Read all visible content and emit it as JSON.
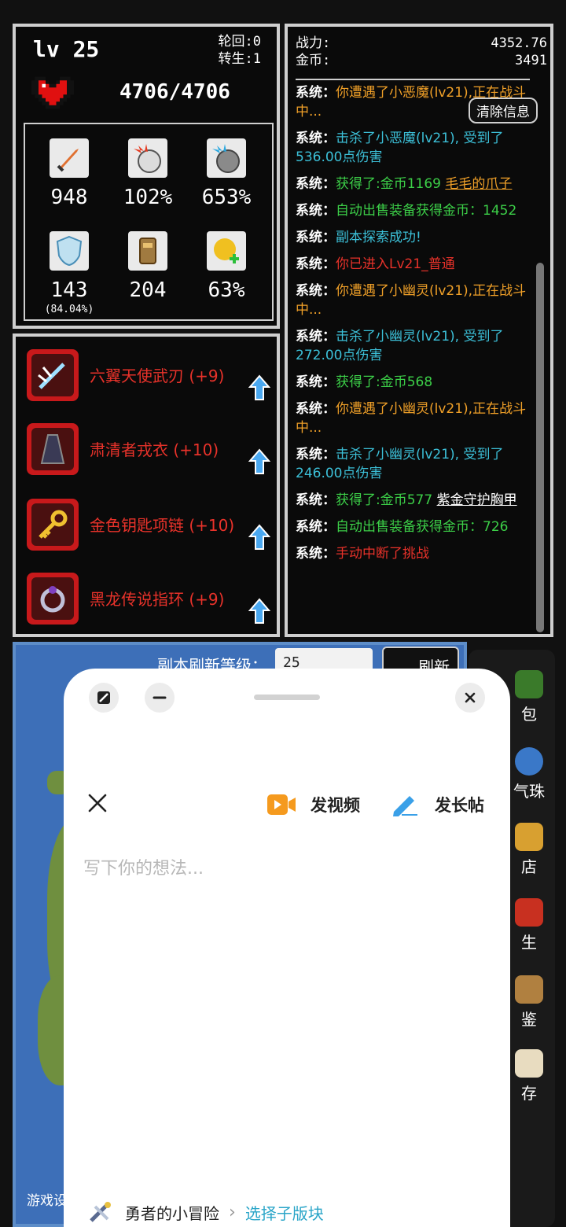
{
  "stats": {
    "level": "lv 25",
    "reincarnation": "轮回:0",
    "rebirth": "转生:1",
    "hp": "4706/4706",
    "attack": "948",
    "crit_rate": "102%",
    "crit_damage": "653%",
    "defense": "143",
    "defense_pct": "(84.04%)",
    "toughness": "204",
    "heal": "63%"
  },
  "equipment": [
    {
      "name": "六翼天使武刃 (+9)"
    },
    {
      "name": "肃清者戎衣 (+10)"
    },
    {
      "name": "金色钥匙项链 (+10)"
    },
    {
      "name": "黑龙传说指环 (+9)"
    }
  ],
  "log_panel": {
    "power_label": "战力:",
    "power_value": "4352.76",
    "gold_label": "金币:",
    "gold_value": "3491",
    "clear_button": "清除信息",
    "sys": "系统：",
    "entries": [
      {
        "text": "你遭遇了小恶魔(lv21),正在战斗中...",
        "color": "#f0a028"
      },
      {
        "text": "击杀了小恶魔(lv21), 受到了536.00点伤害",
        "color": "#3cc0d8"
      },
      {
        "text": "获得了:金币1169",
        "color": "#3ccf48",
        "extra": "毛毛的爪子"
      },
      {
        "text": "自动出售装备获得金币：1452",
        "color": "#3ccf48"
      },
      {
        "text": "副本探索成功!",
        "color": "#3cc0d8"
      },
      {
        "text": "你已进入Lv21_普通",
        "color": "#e8322a"
      },
      {
        "text": "你遭遇了小幽灵(lv21),正在战斗中...",
        "color": "#f0a028"
      },
      {
        "text": "击杀了小幽灵(lv21), 受到了272.00点伤害",
        "color": "#3cc0d8"
      },
      {
        "text": "获得了:金币568",
        "color": "#3ccf48"
      },
      {
        "text": "你遭遇了小幽灵(lv21),正在战斗中...",
        "color": "#f0a028"
      },
      {
        "text": "击杀了小幽灵(lv21), 受到了246.00点伤害",
        "color": "#3cc0d8"
      },
      {
        "text": "获得了:金币577",
        "color": "#3ccf48",
        "extra": "紫金守护胸甲"
      },
      {
        "text": "自动出售装备获得金币：726",
        "color": "#3ccf48"
      },
      {
        "text": "手动中断了挑战",
        "color": "#e8322a"
      }
    ]
  },
  "map": {
    "refresh_level_label": "副本刷新等级：",
    "refresh_level_value": "25",
    "refresh_button": "刷新",
    "bottom_left_label": "游戏设"
  },
  "side_menu": {
    "items": [
      "包",
      "气珠",
      "店",
      "生",
      "鉴",
      "存"
    ]
  },
  "sheet": {
    "post_video": "发视频",
    "post_long": "发长帖",
    "placeholder": "写下你的想法...",
    "board_name": "勇者的小冒险",
    "choose_sub": "选择子版块"
  }
}
